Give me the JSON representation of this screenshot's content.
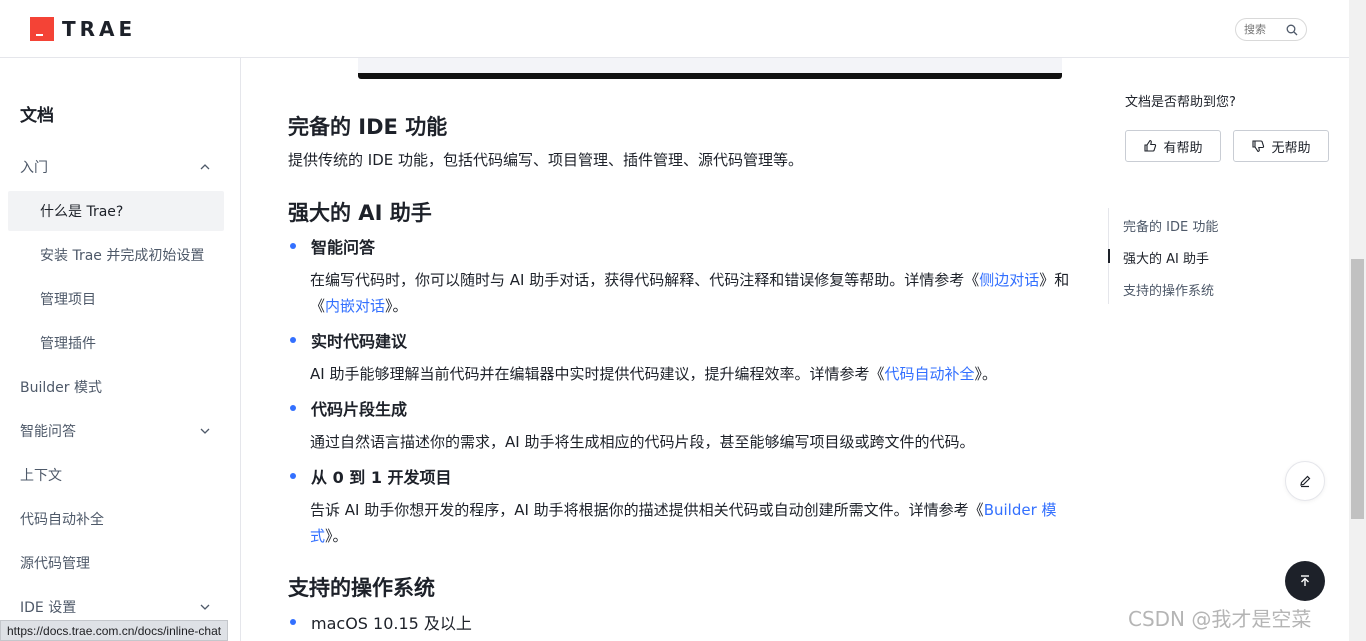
{
  "header": {
    "logo_text": "TRAE",
    "search_placeholder": "搜索"
  },
  "sidebar": {
    "title": "文档",
    "items": [
      {
        "label": "入门",
        "expanded": true
      },
      {
        "label": "什么是 Trae?",
        "active": true
      },
      {
        "label": "安装 Trae 并完成初始设置"
      },
      {
        "label": "管理项目"
      },
      {
        "label": "管理插件"
      },
      {
        "label": "Builder 模式"
      },
      {
        "label": "智能问答",
        "expandable": true
      },
      {
        "label": "上下文"
      },
      {
        "label": "代码自动补全"
      },
      {
        "label": "源代码管理"
      },
      {
        "label": "IDE 设置",
        "expandable": true
      }
    ]
  },
  "main": {
    "sec1": {
      "title": "完备的 IDE 功能",
      "text": "提供传统的 IDE 功能，包括代码编写、项目管理、插件管理、源代码管理等。"
    },
    "sec2": {
      "title": "强大的 AI 助手",
      "items": [
        {
          "title": "智能问答",
          "desc_a": "在编写代码时，你可以随时与 AI 助手对话，获得代码解释、代码注释和错误修复等帮助。详情参考《",
          "link1": "侧边对话",
          "desc_b": "》和《",
          "link2": "内嵌对话",
          "desc_c": "》。"
        },
        {
          "title": "实时代码建议",
          "desc_a": "AI 助手能够理解当前代码并在编辑器中实时提供代码建议，提升编程效率。详情参考《",
          "link1": "代码自动补全",
          "desc_b": "》。"
        },
        {
          "title": "代码片段生成",
          "desc_a": "通过自然语言描述你的需求，AI 助手将生成相应的代码片段，甚至能够编写项目级或跨文件的代码。"
        },
        {
          "title": "从 0 到 1 开发项目",
          "desc_a": "告诉 AI 助手你想开发的程序，AI 助手将根据你的描述提供相关代码或自动创建所需文件。详情参考《",
          "link1": "Builder 模式",
          "desc_b": "》。"
        }
      ]
    },
    "sec3": {
      "title": "支持的操作系统",
      "items": [
        "macOS 10.15 及以上"
      ]
    }
  },
  "right_panel": {
    "question": "文档是否帮助到您?",
    "helpful": "有帮助",
    "not_helpful": "无帮助",
    "toc": [
      "完备的 IDE 功能",
      "强大的 AI 助手",
      "支持的操作系统"
    ],
    "toc_active_index": 1
  },
  "status_url": "https://docs.trae.com.cn/docs/inline-chat",
  "watermark": "CSDN @我才是空菜",
  "colors": {
    "accent": "#3370ff",
    "brand": "#f44336",
    "text": "#1d2129"
  }
}
